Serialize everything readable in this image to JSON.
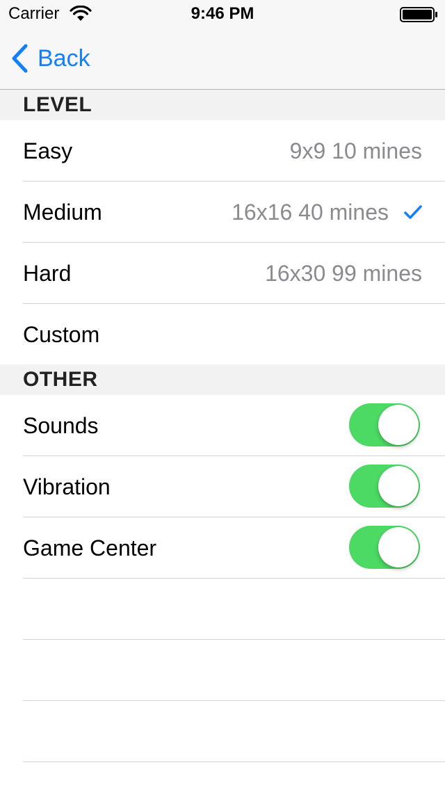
{
  "status_bar": {
    "carrier": "Carrier",
    "time": "9:46 PM",
    "wifi_icon": "wifi-icon",
    "battery_icon": "battery-full-icon"
  },
  "nav": {
    "back_label": "Back",
    "back_icon": "chevron-left-icon",
    "accent_color": "#147efb"
  },
  "level_section": {
    "header": "LEVEL",
    "rows": [
      {
        "label": "Easy",
        "detail": "9x9 10 mines",
        "selected": false
      },
      {
        "label": "Medium",
        "detail": "16x16 40 mines",
        "selected": true
      },
      {
        "label": "Hard",
        "detail": "16x30 99 mines",
        "selected": false
      },
      {
        "label": "Custom",
        "detail": "",
        "selected": false
      }
    ]
  },
  "other_section": {
    "header": "OTHER",
    "rows": [
      {
        "label": "Sounds",
        "on": true
      },
      {
        "label": "Vibration",
        "on": true
      },
      {
        "label": "Game Center",
        "on": true
      }
    ],
    "toggle_on_color": "#4cd964"
  }
}
